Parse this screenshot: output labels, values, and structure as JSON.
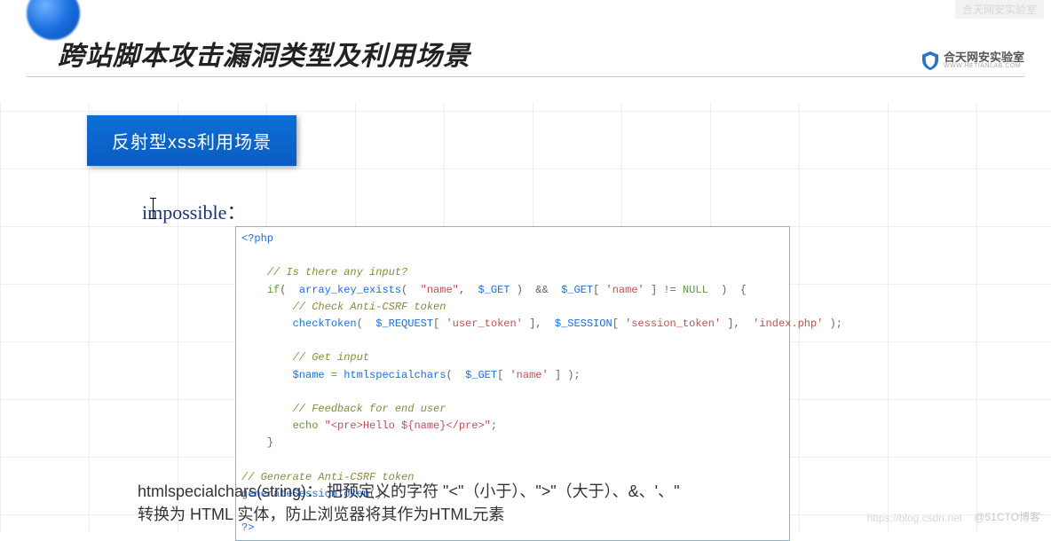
{
  "slide": {
    "title": "跨站脚本攻击漏洞类型及利用场景",
    "logo_text": "合天网安实验室",
    "logo_sub": "WWW.HETIANLAB.COM",
    "badge": "反射型xss利用场景",
    "impossible_label": "impossible：",
    "explanation_line1": "htmlspecialchars(string)： 把预定义的字符 \"<\"（小于）、\">\"（大于）、&、'、\"",
    "explanation_line2": "转换为 HTML 实体，防止浏览器将其作为HTML元素"
  },
  "watermarks": {
    "top": "合天网安实验室",
    "csdn": "https://blog.csdn.net",
    "right": "@51CTO博客"
  },
  "code": {
    "open_tag": "<?php",
    "c1": "// Is there any input?",
    "if_line": {
      "kw": "if",
      "p1": "(  ",
      "fn": "array_key_exists",
      "p2": "(  ",
      "s1": "\"name\"",
      "p3": ",  ",
      "v1": "$_GET",
      "p4": " )  &&  ",
      "v2": "$_GET",
      "p5": "[ ",
      "s2": "'name'",
      "p6": " ] != ",
      "nn": "NULL",
      "p7": "  )  {"
    },
    "c2": "// Check Anti-CSRF token",
    "check_line": {
      "fn": "checkToken",
      "p1": "(  ",
      "v1": "$_REQUEST",
      "p2": "[ ",
      "s1": "'user_token'",
      "p3": " ],  ",
      "v2": "$_SESSION",
      "p4": "[ ",
      "s2": "'session_token'",
      "p5": " ],  ",
      "s3": "'index.php'",
      "p6": " );"
    },
    "c3": "// Get input",
    "name_line": {
      "v1": "$name",
      "eq": " = ",
      "fn": "htmlspecialchars",
      "p1": "(  ",
      "v2": "$_GET",
      "p2": "[ ",
      "s1": "'name'",
      "p3": " ] );"
    },
    "c4": "// Feedback for end user",
    "echo_line": {
      "kw": "echo",
      "sp": " ",
      "s1": "\"<pre>Hello ${name}</pre>\"",
      "end": ";"
    },
    "brace_close": "}",
    "c5": "// Generate Anti-CSRF token",
    "gen_line": {
      "fn": "generateSessionToken",
      "p": "();"
    },
    "close_tag": "?>"
  }
}
